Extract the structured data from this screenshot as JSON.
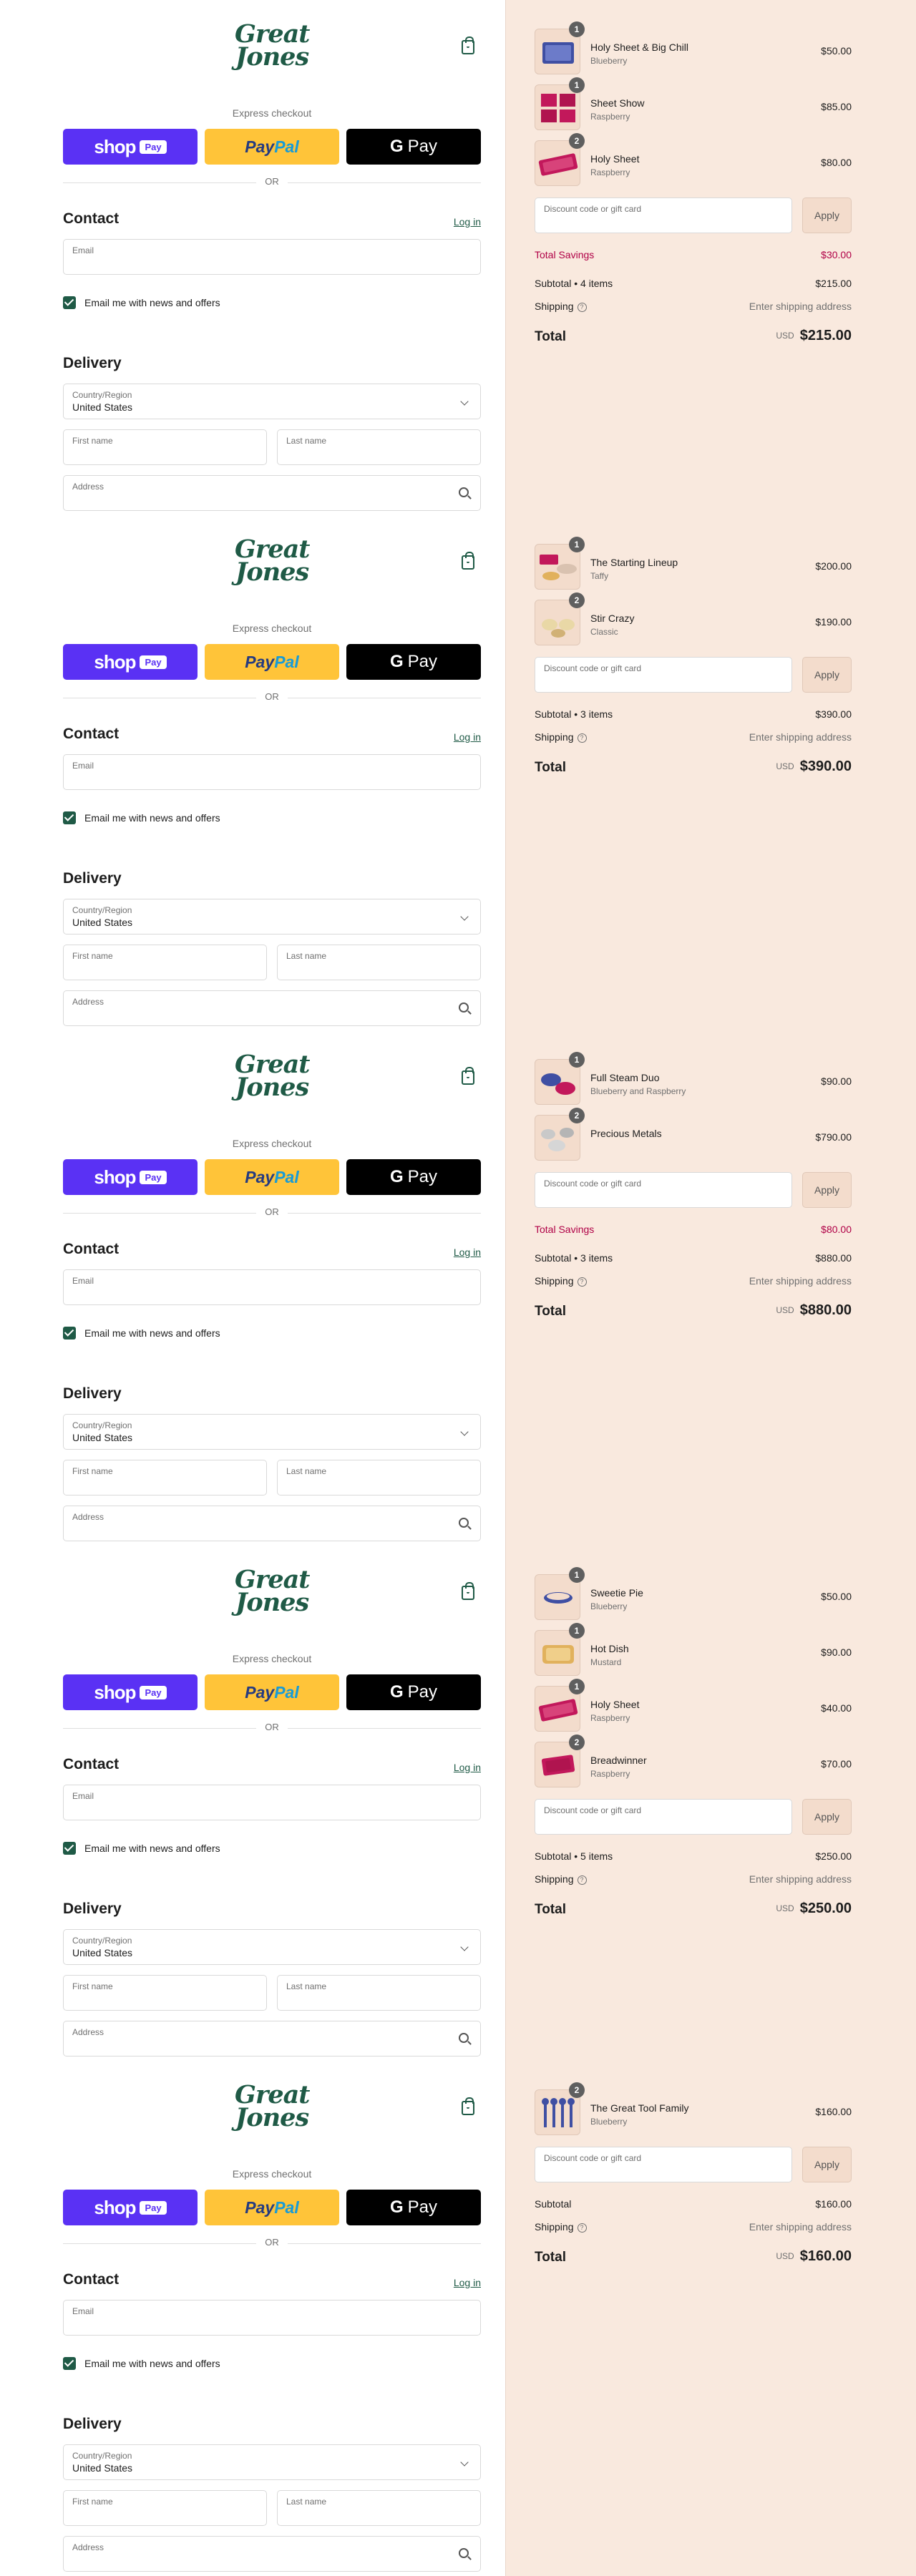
{
  "header": {
    "logo_line1": "Great",
    "logo_line2": "Jones"
  },
  "checkout": {
    "express_label": "Express checkout",
    "shop_pay_label": "shop",
    "shop_pay_badge": "Pay",
    "paypal_label_1": "Pay",
    "paypal_label_2": "Pal",
    "gpay_g": "G",
    "gpay_label": "Pay",
    "or_label": "OR",
    "contact_heading": "Contact",
    "login_label": "Log in",
    "email_label": "Email",
    "newsletter_label": "Email me with news and offers",
    "newsletter_checked": true,
    "delivery_heading": "Delivery",
    "country_label": "Country/Region",
    "country_value": "United States",
    "first_name_label": "First name",
    "last_name_label": "Last name",
    "address_label": "Address"
  },
  "summary_labels": {
    "discount_placeholder": "Discount code or gift card",
    "apply_label": "Apply",
    "total_savings_label": "Total Savings",
    "shipping_label": "Shipping",
    "shipping_value": "Enter shipping address",
    "total_label": "Total",
    "currency": "USD",
    "help_icon": "?"
  },
  "colors": {
    "brand_green": "#1f5a46",
    "shop_pay": "#5a31f4",
    "paypal": "#ffc439",
    "summary_bg": "#f9e9de",
    "savings": "#b00046"
  },
  "carts": [
    {
      "items": [
        {
          "qty": "1",
          "name": "Holy Sheet & Big Chill",
          "variant": "Blueberry",
          "price": "$50.00",
          "thumb": "blue-tray"
        },
        {
          "qty": "1",
          "name": "Sheet Show",
          "variant": "Raspberry",
          "price": "$85.00",
          "thumb": "red-sheets"
        },
        {
          "qty": "2",
          "name": "Holy Sheet",
          "variant": "Raspberry",
          "price": "$80.00",
          "thumb": "red-tray"
        }
      ],
      "total_savings": "$30.00",
      "subtotal_label": "Subtotal • 4 items",
      "subtotal": "$215.00",
      "total": "$215.00"
    },
    {
      "items": [
        {
          "qty": "1",
          "name": "The Starting Lineup",
          "variant": "Taffy",
          "price": "$200.00",
          "thumb": "lineup"
        },
        {
          "qty": "2",
          "name": "Stir Crazy",
          "variant": "Classic",
          "price": "$190.00",
          "thumb": "pots"
        }
      ],
      "total_savings": "",
      "subtotal_label": "Subtotal • 3 items",
      "subtotal": "$390.00",
      "total": "$390.00"
    },
    {
      "items": [
        {
          "qty": "1",
          "name": "Full Steam Duo",
          "variant": "Blueberry and Raspberry",
          "price": "$90.00",
          "thumb": "steam-duo"
        },
        {
          "qty": "2",
          "name": "Precious Metals",
          "variant": "",
          "price": "$790.00",
          "thumb": "metals"
        }
      ],
      "total_savings": "$80.00",
      "subtotal_label": "Subtotal • 3 items",
      "subtotal": "$880.00",
      "total": "$880.00"
    },
    {
      "items": [
        {
          "qty": "1",
          "name": "Sweetie Pie",
          "variant": "Blueberry",
          "price": "$50.00",
          "thumb": "pie"
        },
        {
          "qty": "1",
          "name": "Hot Dish",
          "variant": "Mustard",
          "price": "$90.00",
          "thumb": "dish"
        },
        {
          "qty": "1",
          "name": "Holy Sheet",
          "variant": "Raspberry",
          "price": "$40.00",
          "thumb": "red-tray"
        },
        {
          "qty": "2",
          "name": "Breadwinner",
          "variant": "Raspberry",
          "price": "$70.00",
          "thumb": "loaf"
        }
      ],
      "total_savings": "",
      "subtotal_label": "Subtotal • 5 items",
      "subtotal": "$250.00",
      "total": "$250.00"
    },
    {
      "items": [
        {
          "qty": "2",
          "name": "The Great Tool Family",
          "variant": "Blueberry",
          "price": "$160.00",
          "thumb": "tools"
        }
      ],
      "total_savings": "",
      "subtotal_label": "Subtotal",
      "subtotal": "$160.00",
      "total": "$160.00"
    }
  ]
}
